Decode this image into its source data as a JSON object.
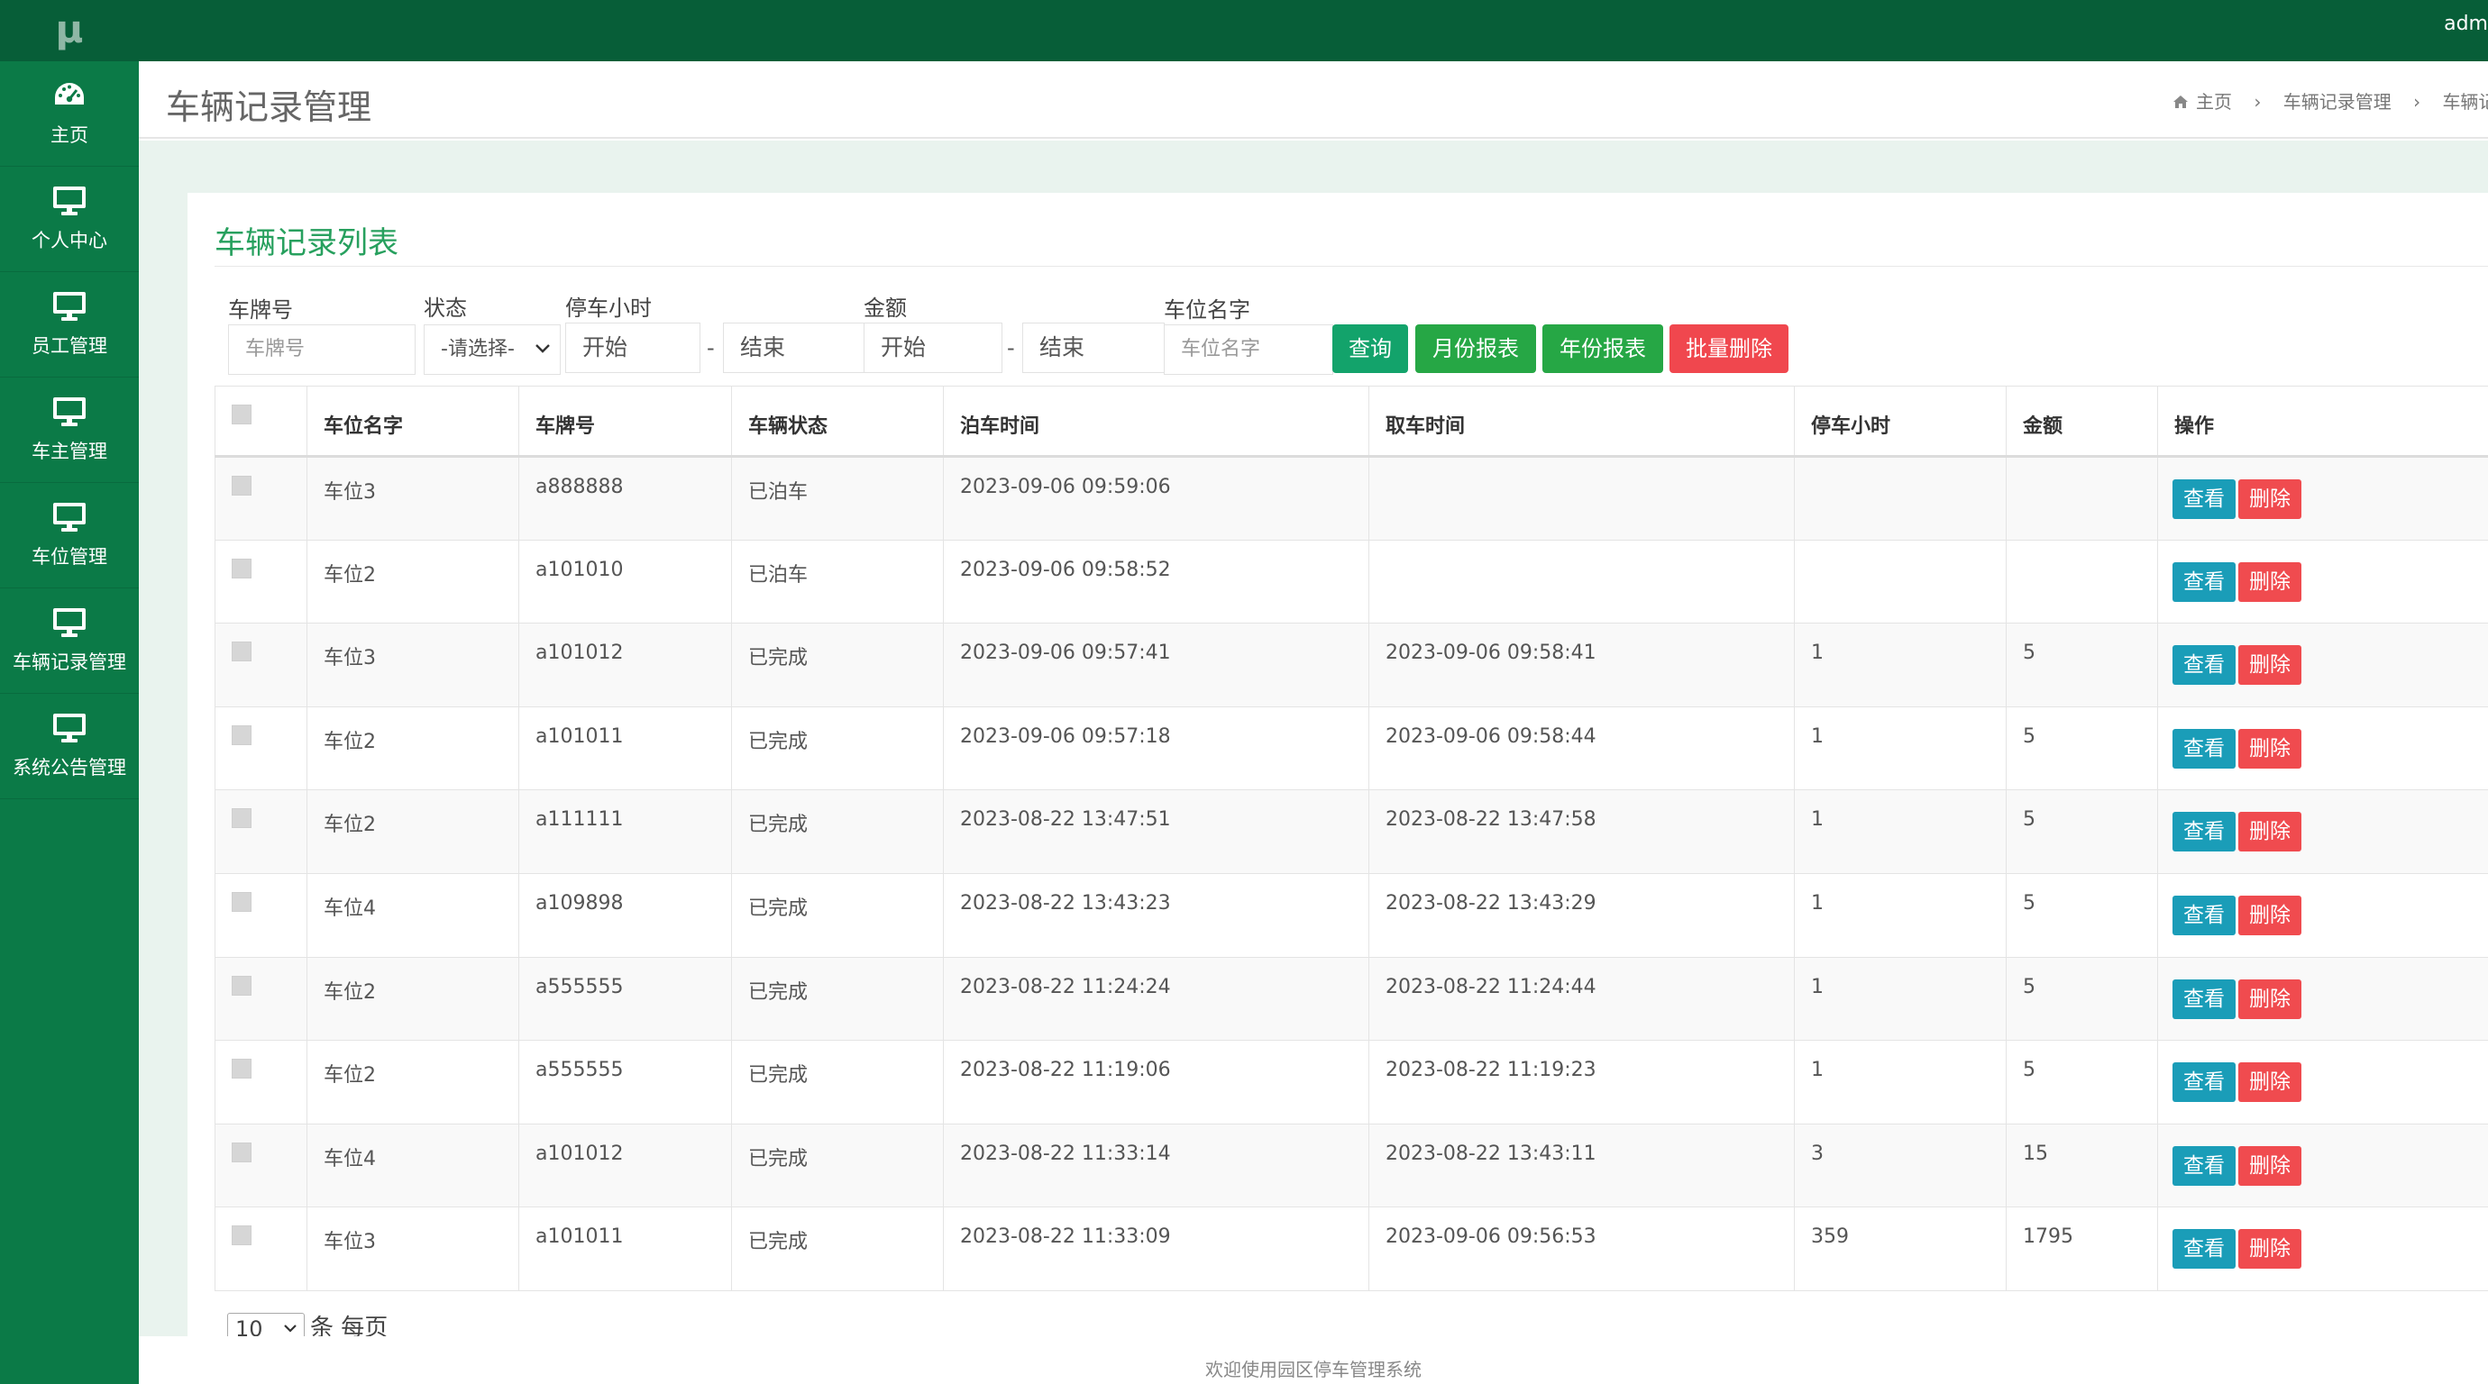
{
  "app": {
    "logo": "μ",
    "user": "adm"
  },
  "sidebar": {
    "items": [
      {
        "label": "主页",
        "icon": "dashboard-icon"
      },
      {
        "label": "个人中心",
        "icon": "monitor-icon"
      },
      {
        "label": "员工管理",
        "icon": "monitor-icon"
      },
      {
        "label": "车主管理",
        "icon": "monitor-icon"
      },
      {
        "label": "车位管理",
        "icon": "monitor-icon"
      },
      {
        "label": "车辆记录管理",
        "icon": "monitor-icon"
      },
      {
        "label": "系统公告管理",
        "icon": "monitor-icon"
      }
    ]
  },
  "header": {
    "title": "车辆记录管理",
    "breadcrumb": [
      "主页",
      "车辆记录管理",
      "车辆记"
    ],
    "separator": "›"
  },
  "panel": {
    "title": "车辆记录列表"
  },
  "filters": {
    "plate_label": "车牌号",
    "plate_placeholder": "车牌号",
    "status_label": "状态",
    "status_value": "-请选择-",
    "hours_label": "停车小时",
    "hours_start": "开始",
    "hours_end": "结束",
    "amount_label": "金额",
    "amount_start": "开始",
    "amount_end": "结束",
    "dash": "-",
    "space_label": "车位名字",
    "space_placeholder": "车位名字"
  },
  "buttons": {
    "query": "查询",
    "monthly": "月份报表",
    "yearly": "年份报表",
    "batch_delete": "批量删除"
  },
  "table": {
    "columns": [
      "车位名字",
      "车牌号",
      "车辆状态",
      "泊车时间",
      "取车时间",
      "停车小时",
      "金额",
      "操作"
    ],
    "view_label": "查看",
    "delete_label": "删除",
    "rows": [
      {
        "space": "车位3",
        "plate": "a888888",
        "status": "已泊车",
        "park_time": "2023-09-06 09:59:06",
        "pick_time": "",
        "hours": "",
        "amount": ""
      },
      {
        "space": "车位2",
        "plate": "a101010",
        "status": "已泊车",
        "park_time": "2023-09-06 09:58:52",
        "pick_time": "",
        "hours": "",
        "amount": ""
      },
      {
        "space": "车位3",
        "plate": "a101012",
        "status": "已完成",
        "park_time": "2023-09-06 09:57:41",
        "pick_time": "2023-09-06 09:58:41",
        "hours": "1",
        "amount": "5"
      },
      {
        "space": "车位2",
        "plate": "a101011",
        "status": "已完成",
        "park_time": "2023-09-06 09:57:18",
        "pick_time": "2023-09-06 09:58:44",
        "hours": "1",
        "amount": "5"
      },
      {
        "space": "车位2",
        "plate": "a111111",
        "status": "已完成",
        "park_time": "2023-08-22 13:47:51",
        "pick_time": "2023-08-22 13:47:58",
        "hours": "1",
        "amount": "5"
      },
      {
        "space": "车位4",
        "plate": "a109898",
        "status": "已完成",
        "park_time": "2023-08-22 13:43:23",
        "pick_time": "2023-08-22 13:43:29",
        "hours": "1",
        "amount": "5"
      },
      {
        "space": "车位2",
        "plate": "a555555",
        "status": "已完成",
        "park_time": "2023-08-22 11:24:24",
        "pick_time": "2023-08-22 11:24:44",
        "hours": "1",
        "amount": "5"
      },
      {
        "space": "车位2",
        "plate": "a555555",
        "status": "已完成",
        "park_time": "2023-08-22 11:19:06",
        "pick_time": "2023-08-22 11:19:23",
        "hours": "1",
        "amount": "5"
      },
      {
        "space": "车位4",
        "plate": "a101012",
        "status": "已完成",
        "park_time": "2023-08-22 11:33:14",
        "pick_time": "2023-08-22 13:43:11",
        "hours": "3",
        "amount": "15"
      },
      {
        "space": "车位3",
        "plate": "a101011",
        "status": "已完成",
        "park_time": "2023-08-22 11:33:09",
        "pick_time": "2023-09-06 09:56:53",
        "hours": "359",
        "amount": "1795"
      }
    ]
  },
  "pager": {
    "page_size": "10",
    "suffix": "条 每页"
  },
  "footer": {
    "text": "欢迎使用园区停车管理系统"
  }
}
